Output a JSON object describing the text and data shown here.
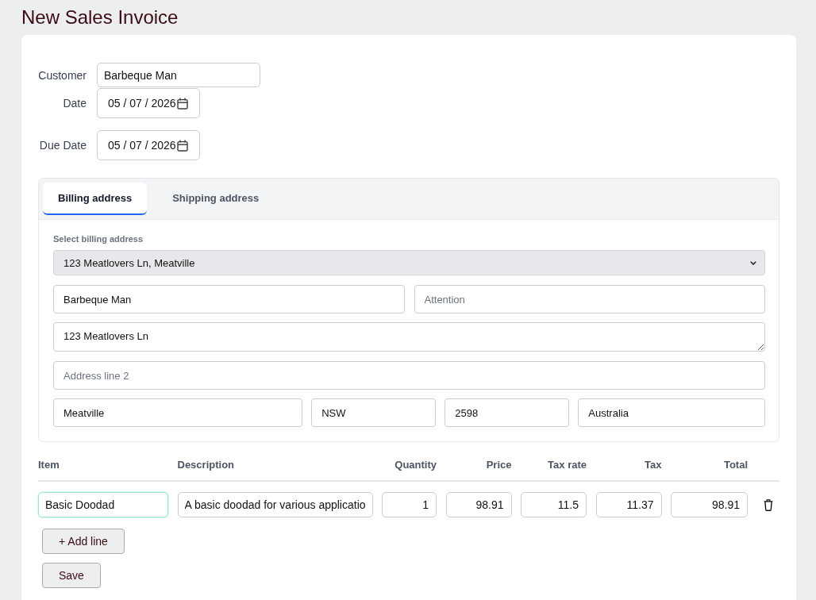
{
  "page": {
    "title": "New Sales Invoice"
  },
  "header_fields": [
    {
      "kind": "text",
      "label": "Customer",
      "value": "Barbeque Man"
    },
    {
      "kind": "date",
      "label": "Date",
      "value": "05 / 07 / 2026"
    },
    {
      "kind": "date",
      "label": "Due Date",
      "value": "05 / 07 / 2026"
    }
  ],
  "address_tabs": [
    {
      "label": "Billing address",
      "selected": true
    },
    {
      "label": "Shipping address",
      "selected": false
    }
  ],
  "address_form": {
    "select_label": "Select billing address",
    "select_value": "123 Meatlovers Ln, Meatville",
    "recipient_name": {
      "value": "Barbeque Man"
    },
    "attention": {
      "placeholder": "Attention"
    },
    "address_line_1": {
      "value": "123 Meatlovers Ln"
    },
    "address_line_2": {
      "placeholder": "Address line 2"
    },
    "city": {
      "value": "Meatville"
    },
    "state": {
      "value": "NSW"
    },
    "postcode": {
      "value": "2598"
    },
    "country": {
      "value": "Australia"
    }
  },
  "lines_table": {
    "columns": [
      "Item",
      "Description",
      "Quantity",
      "Price",
      "Tax rate",
      "Tax",
      "Total"
    ],
    "rows": [
      {
        "cells": [
          {
            "value": "Basic Doodad",
            "focused": true
          },
          {
            "value": "A basic doodad for various applicatio",
            "focused": false
          },
          {
            "value": "1",
            "focused": false
          },
          {
            "value": "98.91",
            "focused": false
          },
          {
            "value": "11.5",
            "focused": false
          },
          {
            "value": "11.37",
            "focused": false
          },
          {
            "value": "98.91",
            "focused": false
          }
        ]
      }
    ]
  },
  "buttons": [
    "+ Add line",
    "Save"
  ]
}
